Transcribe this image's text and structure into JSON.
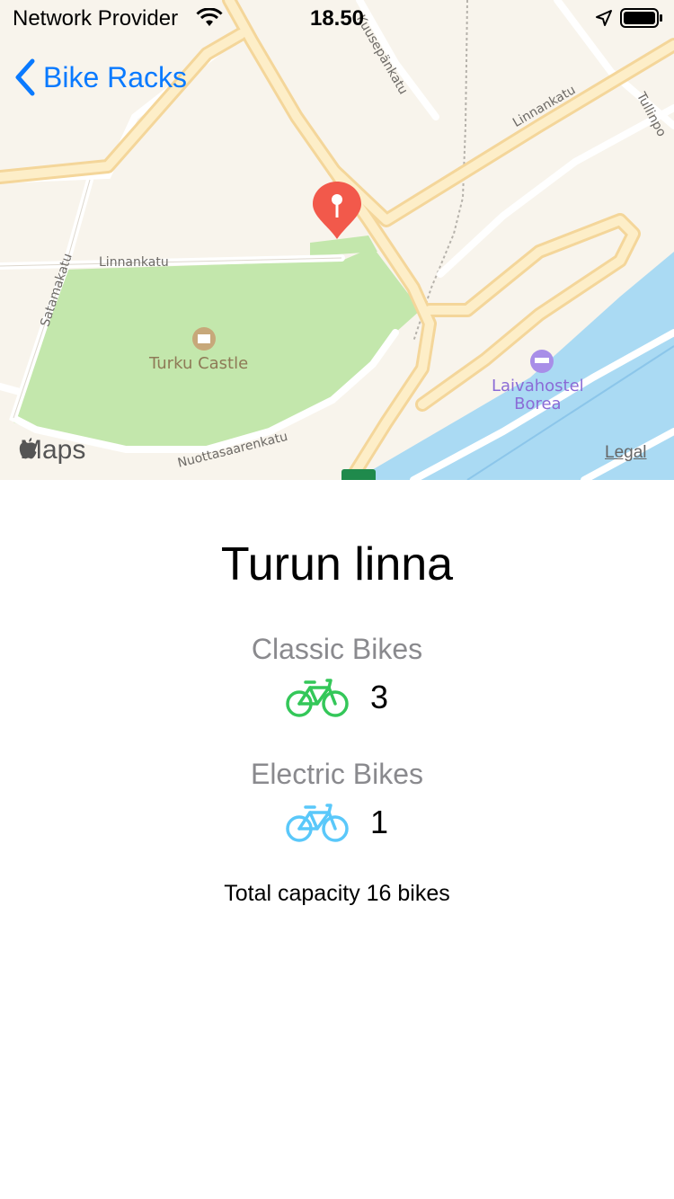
{
  "status_bar": {
    "carrier": "Network Provider",
    "time": "18.50"
  },
  "nav": {
    "back_label": "Bike Racks",
    "accent_color": "#0a7aff"
  },
  "map": {
    "streets": {
      "linnankatu_east": "Linnankatu",
      "linnankatu_west": "Linnankatu",
      "satamakatu": "Satamakatu",
      "nuottasaarenkatu": "Nuottasaarenkatu",
      "kuusepankatu": "Kuusepänkatu",
      "tullinportti": "Tullinpo"
    },
    "poi_castle": "Turku Castle",
    "poi_hostel_line1": "Laivahostel",
    "poi_hostel_line2": "Borea",
    "maps_logo": "Maps",
    "legal": "Legal",
    "pin_color": "#f2594b",
    "water_color": "#aadaf3",
    "park_color": "#c3e7ac"
  },
  "station": {
    "name": "Turun linna",
    "classic_label": "Classic Bikes",
    "classic_count": "3",
    "classic_color": "#34c759",
    "electric_label": "Electric Bikes",
    "electric_count": "1",
    "electric_color": "#5ac8fa",
    "capacity_text": "Total capacity 16 bikes"
  }
}
